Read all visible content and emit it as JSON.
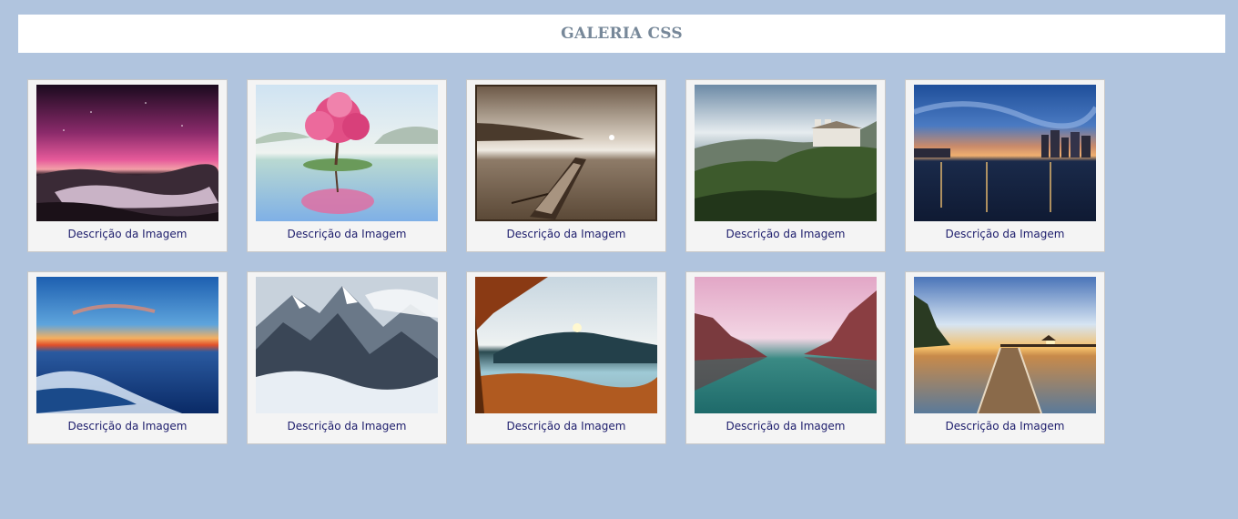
{
  "header": {
    "title": "GALERIA CSS"
  },
  "gallery": {
    "items": [
      {
        "caption": "Descrição da Imagem",
        "icon": "aurora-beach-image"
      },
      {
        "caption": "Descrição da Imagem",
        "icon": "cherry-tree-image"
      },
      {
        "caption": "Descrição da Imagem",
        "icon": "sepia-boat-image"
      },
      {
        "caption": "Descrição da Imagem",
        "icon": "hill-church-image"
      },
      {
        "caption": "Descrição da Imagem",
        "icon": "city-night-image"
      },
      {
        "caption": "Descrição da Imagem",
        "icon": "ocean-sunset-image"
      },
      {
        "caption": "Descrição da Imagem",
        "icon": "snowy-mountains-image"
      },
      {
        "caption": "Descrição da Imagem",
        "icon": "autumn-lake-image"
      },
      {
        "caption": "Descrição da Imagem",
        "icon": "pink-sky-lake-image"
      },
      {
        "caption": "Descrição da Imagem",
        "icon": "pier-sunset-image"
      }
    ]
  },
  "colors": {
    "background": "#b0c4de",
    "header_bg": "#ffffff",
    "title": "#778899",
    "card_bg": "#f4f4f4",
    "caption": "#1c1c6b"
  }
}
